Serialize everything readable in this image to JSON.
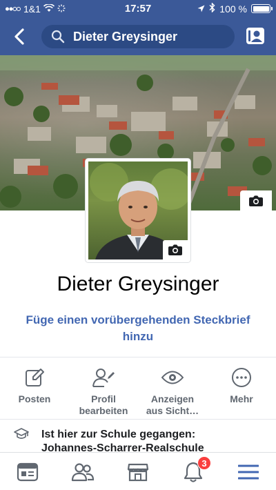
{
  "status_bar": {
    "carrier": "1&1",
    "time": "17:57",
    "battery": "100 %"
  },
  "nav": {
    "search_text": "Dieter Greysinger"
  },
  "profile": {
    "name": "Dieter Greysinger",
    "bio_prompt_line1": "Füge einen vorübergehenden Steckbrief",
    "bio_prompt_line2": "hinzu"
  },
  "actions": [
    {
      "label_line1": "Posten",
      "label_line2": "",
      "icon": "pencil-square-icon"
    },
    {
      "label_line1": "Profil",
      "label_line2": "bearbeiten",
      "icon": "user-edit-icon"
    },
    {
      "label_line1": "Anzeigen",
      "label_line2": "aus Sicht…",
      "icon": "eye-icon"
    },
    {
      "label_line1": "Mehr",
      "label_line2": "",
      "icon": "more-dots-icon"
    }
  ],
  "education": {
    "line1": "Ist hier zur Schule gegangen:",
    "line2": "Johannes-Scharrer-Realschule",
    "icon": "graduation-cap-icon"
  },
  "tabbar": {
    "tabs": [
      "news-feed-icon",
      "friends-icon",
      "marketplace-icon",
      "notifications-icon",
      "menu-icon"
    ],
    "notification_count": "3"
  },
  "colors": {
    "brand": "#3b5998",
    "link": "#4267b2",
    "badge": "#fa3e3e",
    "active_tab": "#4267b2"
  }
}
